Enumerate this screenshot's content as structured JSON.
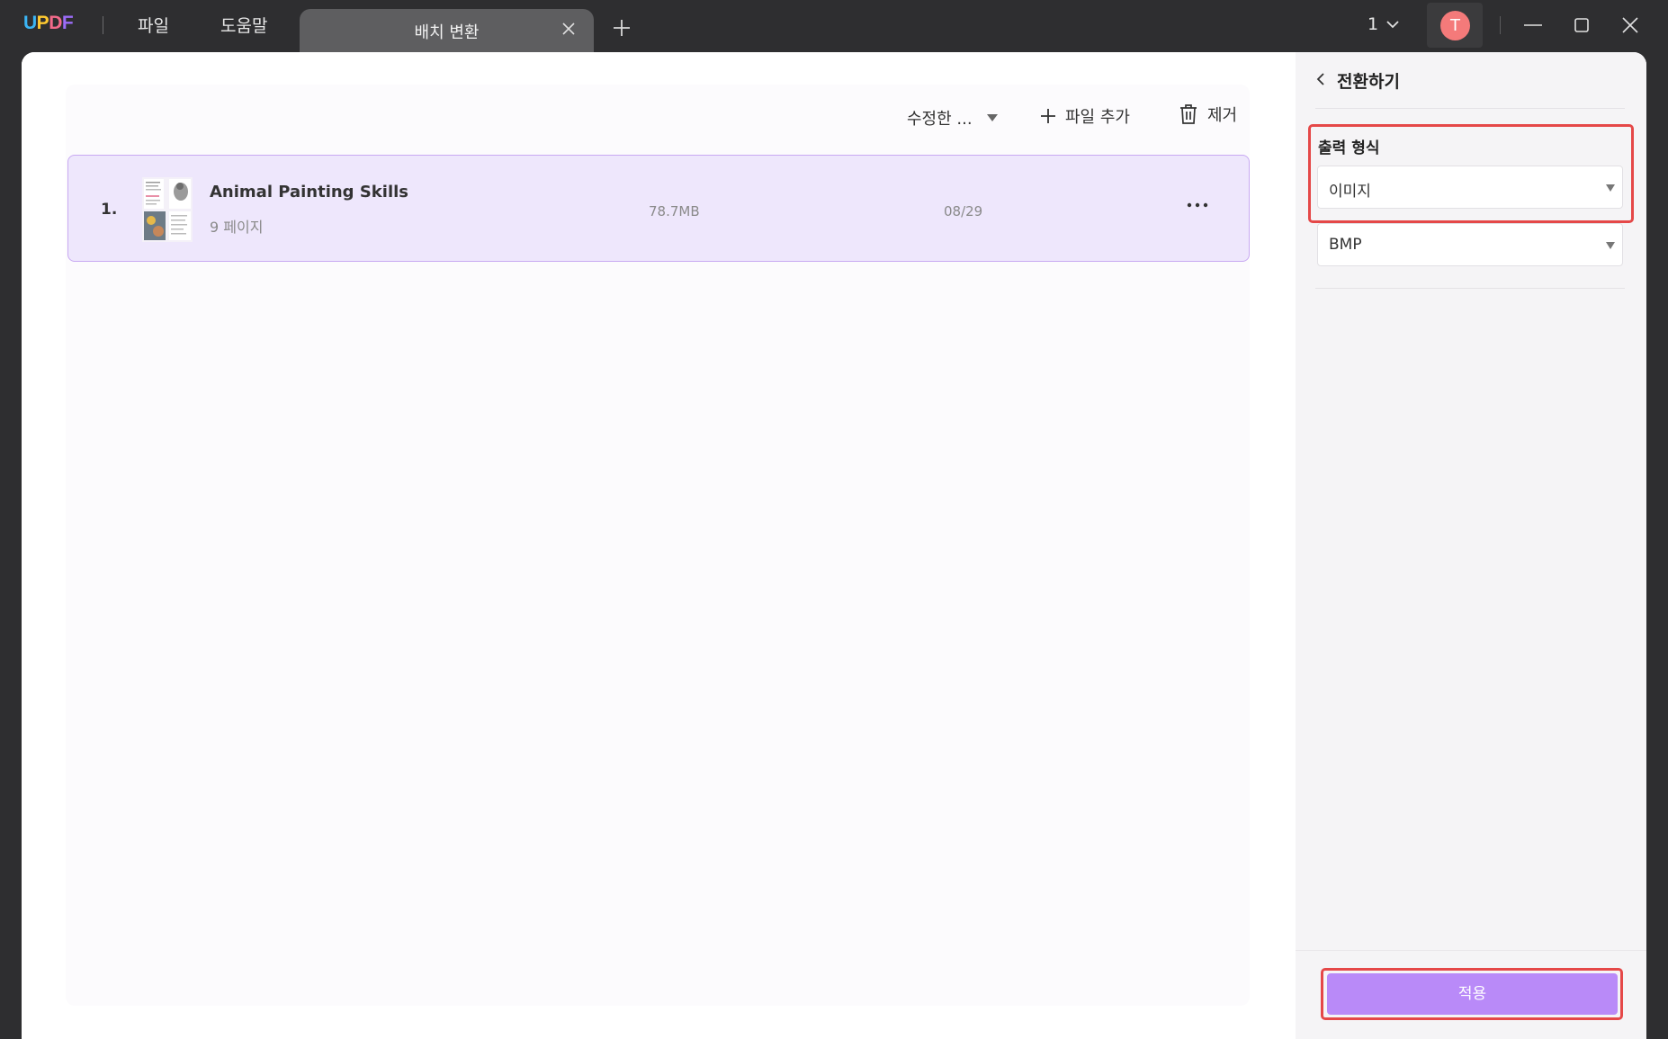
{
  "app": {
    "logo": "UPDF",
    "menu": [
      "파일",
      "도움말"
    ]
  },
  "tabs": [
    {
      "label": "배치 변환"
    }
  ],
  "titlebar": {
    "page_indicator": "1",
    "avatar_initial": "T"
  },
  "toolbar": {
    "sort_label": "수정한 ...",
    "add_file_label": "파일 추가",
    "remove_label": "제거"
  },
  "files": [
    {
      "index": "1.",
      "name": "Animal Painting Skills",
      "pages": "9 페이지",
      "size": "78.7MB",
      "date": "08/29"
    }
  ],
  "sidebar": {
    "title": "전환하기",
    "output_format_label": "출력 형식",
    "format_value": "이미지",
    "subformat_value": "BMP",
    "apply_label": "적용"
  },
  "colors": {
    "accent": "#b98af8",
    "row_bg": "#eee7fc",
    "highlight": "#e54848",
    "titlebar_bg": "#2e2e30"
  },
  "icons": [
    "close-icon",
    "plus-icon",
    "chevron-down-icon",
    "minimize-icon",
    "maximize-icon",
    "trash-icon",
    "more-icon",
    "chevron-left-icon",
    "caret-down-icon"
  ]
}
